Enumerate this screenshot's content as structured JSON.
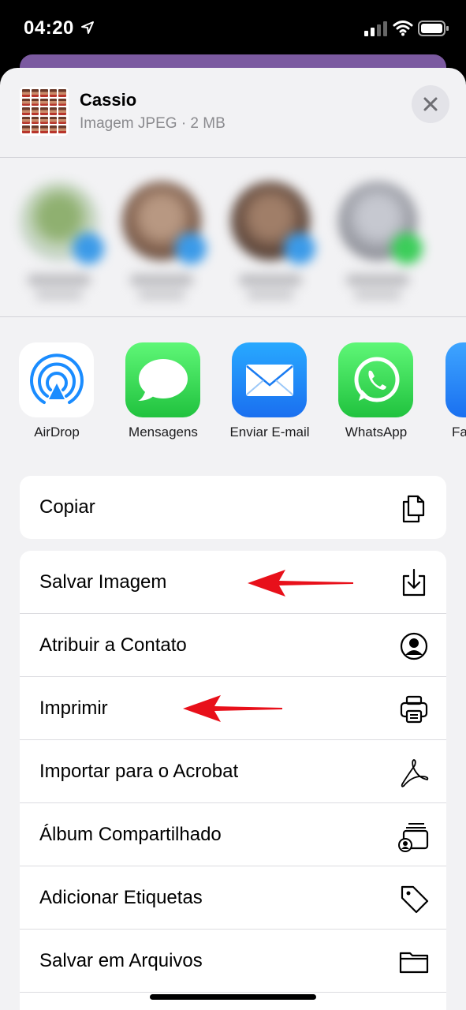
{
  "status_bar": {
    "time": "04:20"
  },
  "share_header": {
    "title": "Cassio",
    "subtitle": "Imagem JPEG · 2 MB"
  },
  "apps": [
    {
      "label": "AirDrop",
      "icon": "airdrop-icon"
    },
    {
      "label": "Mensagens",
      "icon": "messages-icon"
    },
    {
      "label": "Enviar E-mail",
      "icon": "mail-icon"
    },
    {
      "label": "WhatsApp",
      "icon": "whatsapp-icon"
    },
    {
      "label": "Fa",
      "icon": "app-icon"
    }
  ],
  "actions_group1": [
    {
      "label": "Copiar",
      "icon": "copy-icon"
    }
  ],
  "actions_group2": [
    {
      "label": "Salvar Imagem",
      "icon": "save-image-icon"
    },
    {
      "label": "Atribuir a Contato",
      "icon": "contact-icon"
    },
    {
      "label": "Imprimir",
      "icon": "printer-icon"
    },
    {
      "label": "Importar para o Acrobat",
      "icon": "acrobat-icon"
    },
    {
      "label": "Álbum Compartilhado",
      "icon": "shared-album-icon"
    },
    {
      "label": "Adicionar Etiquetas",
      "icon": "tag-icon"
    },
    {
      "label": "Salvar em Arquivos",
      "icon": "folder-icon"
    }
  ],
  "colors": {
    "annotation_arrow": "#e8101a",
    "accent_blue": "#1a8cff",
    "green": "#20c23e"
  }
}
